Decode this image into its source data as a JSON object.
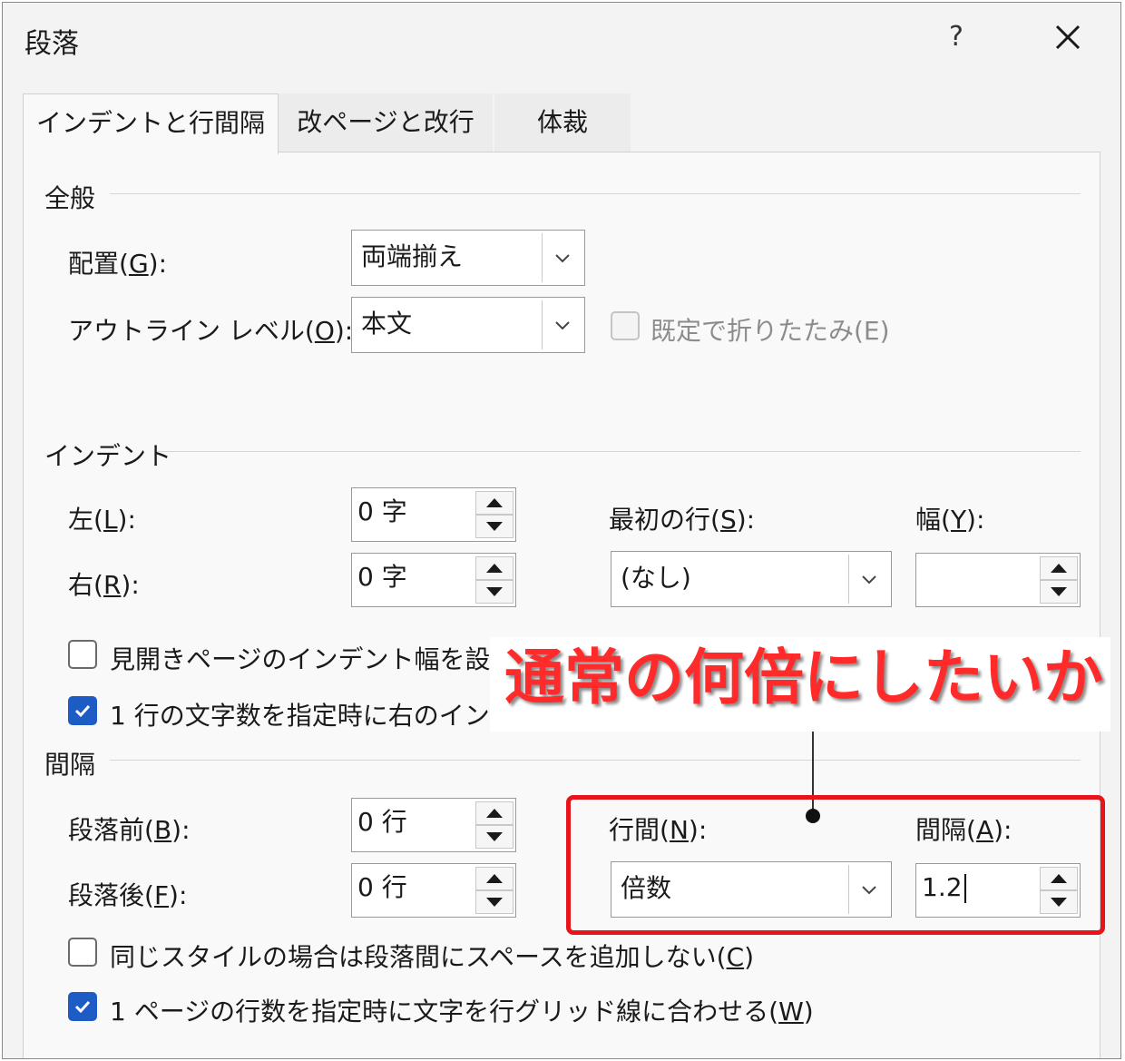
{
  "window": {
    "title": "段落",
    "help": "?"
  },
  "tabs": [
    {
      "label": "インデントと行間隔",
      "active": true
    },
    {
      "label": "改ページと改行",
      "active": false
    },
    {
      "label": "体裁",
      "active": false
    }
  ],
  "general": {
    "heading": "全般",
    "alignment": {
      "label": "配置(",
      "key": "G",
      "tail": "):",
      "value": "両端揃え"
    },
    "outline": {
      "label": "アウトライン レベル(",
      "key": "O",
      "tail": "):",
      "value": "本文"
    },
    "collapse_label": "既定で折りたたみ(E)"
  },
  "indent": {
    "heading": "インデント",
    "left": {
      "label": "左(",
      "key": "L",
      "tail": "):",
      "value": "0 字"
    },
    "right": {
      "label": "右(",
      "key": "R",
      "tail": "):",
      "value": "0 字"
    },
    "first_line": {
      "label": "最初の行(",
      "key": "S",
      "tail": "):",
      "value": "(なし)"
    },
    "width": {
      "label": "幅(",
      "key": "Y",
      "tail": "):",
      "value": ""
    },
    "mirror_label": "見開きページのインデント幅を設定",
    "auto_adjust_label": "1 行の文字数を指定時に右のイン"
  },
  "spacing": {
    "heading": "間隔",
    "before": {
      "label": "段落前(",
      "key": "B",
      "tail": "):",
      "value": "0 行"
    },
    "after": {
      "label": "段落後(",
      "key": "F",
      "tail": "):",
      "value": "0 行"
    },
    "line_spacing": {
      "label": "行間(",
      "key": "N",
      "tail": "):",
      "value": "倍数"
    },
    "at": {
      "label": "間隔(",
      "key": "A",
      "tail": "):",
      "value": "1.2"
    },
    "no_space_pre": "同じスタイルの場合は段落間にスペースを追加しない(",
    "no_space_key": "C",
    "no_space_post": ")",
    "snap_pre": "1 ページの行数を指定時に文字を行グリッド線に合わせる(",
    "snap_key": "W",
    "snap_post": ")"
  },
  "annotation": {
    "text": "通常の何倍にしたいか",
    "color": "#ff2a2a",
    "box_color": "#e8141b"
  },
  "colors": {
    "checkbox_checked": "#1d5cc4",
    "window_bg": "#f3f3f3"
  }
}
